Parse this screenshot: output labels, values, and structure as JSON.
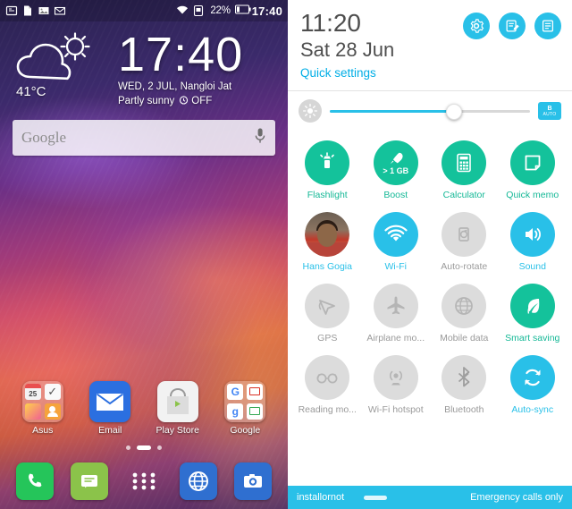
{
  "home": {
    "statusbar": {
      "icons_left": [
        "screenshot-icon",
        "document-icon",
        "image-icon",
        "email-icon"
      ],
      "icons_right": [
        "wifi-icon",
        "sim-icon"
      ],
      "battery_percent": "22%",
      "clock": "17:40"
    },
    "widget": {
      "weather_icon": "partly-sunny-icon",
      "temperature": "41°C",
      "clock": "17:40",
      "date_line": "WED, 2 JUL, Nangloi Jat",
      "condition": "Partly sunny",
      "alarm": "OFF"
    },
    "search": {
      "text": "Google",
      "mic_icon": "microphone-icon"
    },
    "apps": [
      {
        "label": "Asus",
        "icon": "asus-folder-icon"
      },
      {
        "label": "Email",
        "icon": "email-icon"
      },
      {
        "label": "Play Store",
        "icon": "play-store-icon"
      },
      {
        "label": "Google",
        "icon": "google-folder-icon"
      }
    ],
    "page_dots": {
      "count": 3,
      "active_index": 1
    },
    "dock": [
      {
        "label": "Phone",
        "icon": "phone-icon"
      },
      {
        "label": "Messaging",
        "icon": "messaging-icon"
      },
      {
        "label": "All apps",
        "icon": "app-drawer-icon"
      },
      {
        "label": "Browser",
        "icon": "browser-icon"
      },
      {
        "label": "Camera",
        "icon": "camera-icon"
      }
    ]
  },
  "quick_settings": {
    "time": "11:20",
    "date": "Sat 28 Jun",
    "link": "Quick settings",
    "header_buttons": [
      {
        "name": "settings-gear-button",
        "icon": "gear-icon"
      },
      {
        "name": "edit-button",
        "icon": "edit-icon"
      },
      {
        "name": "list-button",
        "icon": "list-icon"
      }
    ],
    "brightness": {
      "left_icon": "brightness-icon",
      "value_percent": 62,
      "auto_label_line1": "B",
      "auto_label_line2": "AUTO"
    },
    "tiles": [
      {
        "label": "Flashlight",
        "state": "green",
        "icon": "flashlight-icon",
        "badge": ""
      },
      {
        "label": "Boost",
        "state": "green",
        "icon": "boost-icon",
        "badge": "> 1 GB"
      },
      {
        "label": "Calculator",
        "state": "green",
        "icon": "calculator-icon",
        "badge": ""
      },
      {
        "label": "Quick memo",
        "state": "green",
        "icon": "quick-memo-icon",
        "badge": ""
      },
      {
        "label": "Hans Gogia",
        "state": "blue",
        "icon": "user-avatar-icon",
        "badge": ""
      },
      {
        "label": "Wi-Fi",
        "state": "blue",
        "icon": "wifi-icon",
        "badge": ""
      },
      {
        "label": "Auto-rotate",
        "state": "off",
        "icon": "auto-rotate-icon",
        "badge": ""
      },
      {
        "label": "Sound",
        "state": "blue",
        "icon": "sound-icon",
        "badge": ""
      },
      {
        "label": "GPS",
        "state": "off",
        "icon": "gps-icon",
        "badge": ""
      },
      {
        "label": "Airplane mo...",
        "state": "off",
        "icon": "airplane-icon",
        "badge": ""
      },
      {
        "label": "Mobile data",
        "state": "off",
        "icon": "mobile-data-icon",
        "badge": ""
      },
      {
        "label": "Smart saving",
        "state": "green",
        "icon": "smart-saving-icon",
        "badge": ""
      },
      {
        "label": "Reading mo...",
        "state": "off",
        "icon": "reading-mode-icon",
        "badge": ""
      },
      {
        "label": "Wi-Fi hotspot",
        "state": "off",
        "icon": "hotspot-icon",
        "badge": ""
      },
      {
        "label": "Bluetooth",
        "state": "off",
        "icon": "bluetooth-icon",
        "badge": ""
      },
      {
        "label": "Auto-sync",
        "state": "blue",
        "icon": "auto-sync-icon",
        "badge": ""
      }
    ],
    "footer": {
      "carrier": "installornot",
      "emergency": "Emergency calls only"
    }
  },
  "colors": {
    "accent_blue": "#29c0e8",
    "accent_green": "#14c29b",
    "tile_off": "#dcdcdc",
    "label_off": "#9a9a9a"
  }
}
